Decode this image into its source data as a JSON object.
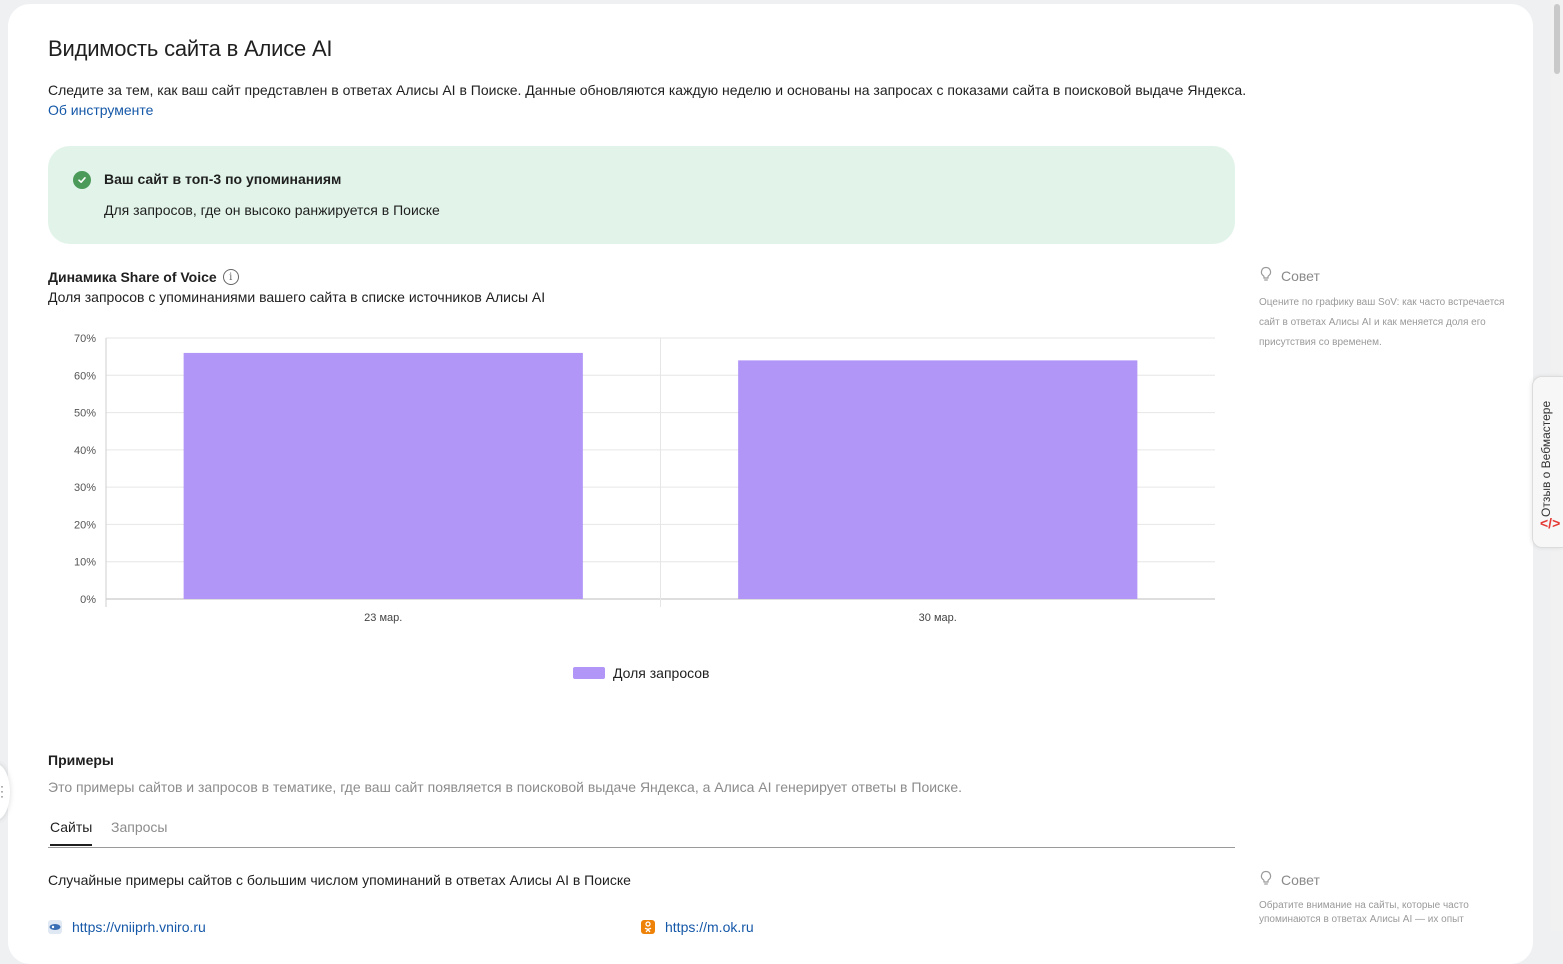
{
  "page": {
    "title": "Видимость сайта в Алисе AI",
    "intro": "Следите за тем, как ваш сайт представлен в ответах Алисы AI в Поиске. Данные обновляются каждую неделю и основаны на запросах с показами сайта в поисковой выдаче Яндекса.",
    "about_link": "Об инструменте"
  },
  "notice": {
    "title": "Ваш сайт в топ-3 по упоминаниям",
    "text": "Для запросов, где он высоко ранжируется в Поиске",
    "icon": "check-circle-icon",
    "color": "#4c9a5a",
    "background": "#e2f4ea"
  },
  "sov": {
    "title": "Динамика Share of Voice",
    "subtitle": "Доля запросов с упоминаниями вашего сайта в списке источников Алисы AI",
    "tip_label": "Совет",
    "tip_text": "Оцените по графику ваш SoV: как часто встречается сайт в ответах Алисы AI и как меняется доля его присутствия со временем."
  },
  "chart_data": {
    "type": "bar",
    "categories": [
      "23 мар.",
      "30 мар."
    ],
    "series": [
      {
        "name": "Доля запросов",
        "values": [
          66,
          64
        ],
        "color": "#b196f8"
      }
    ],
    "y_ticks": [
      "0%",
      "10%",
      "20%",
      "30%",
      "40%",
      "50%",
      "60%",
      "70%"
    ],
    "ylim": [
      0,
      70
    ],
    "grid": true,
    "legend_position": "bottom-center"
  },
  "examples": {
    "title": "Примеры",
    "description": "Это примеры сайтов и запросов в тематике, где ваш сайт появляется в поисковой выдаче Яндекса, а Алиса AI генерирует ответы в Поиске.",
    "tabs": [
      {
        "label": "Сайты",
        "active": true
      },
      {
        "label": "Запросы",
        "active": false
      }
    ],
    "sites_description": "Случайные примеры сайтов с большим числом упоминаний в ответах Алисы AI в Поиске",
    "tip_label": "Совет",
    "tip_text": "Обратите внимание на сайты, которые часто упоминаются в ответах Алисы AI — их опыт",
    "sites": [
      {
        "url": "https://vniiprh.vniro.ru",
        "icon": "vniro-favicon-icon"
      },
      {
        "url": "https://m.ok.ru",
        "icon": "ok-favicon-icon",
        "color": "#ee8208"
      }
    ]
  },
  "feedback": {
    "label": "Отзыв о Вебмастере",
    "icon": "code-brackets-icon"
  }
}
